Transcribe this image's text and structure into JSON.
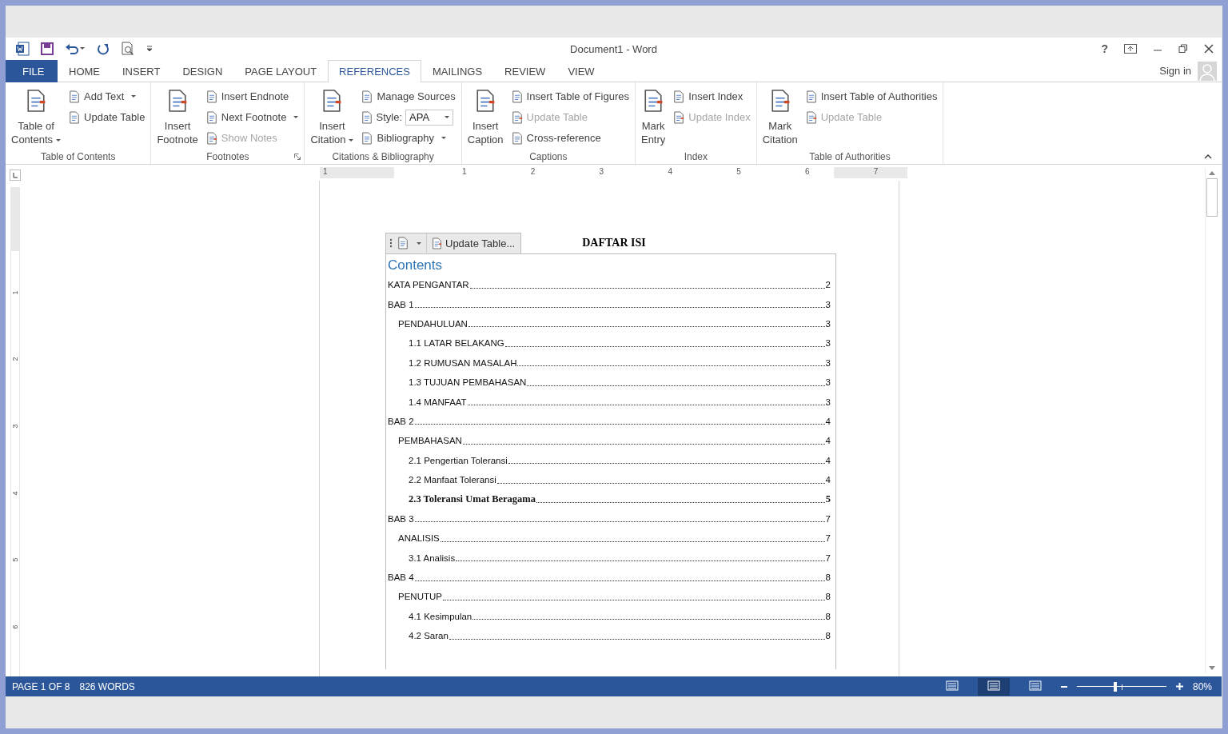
{
  "window": {
    "title": "Document1 - Word",
    "help": "?",
    "sign_in": "Sign in"
  },
  "tabs": [
    {
      "label": "FILE",
      "kind": "file",
      "selected": false
    },
    {
      "label": "HOME",
      "kind": "tab",
      "selected": false
    },
    {
      "label": "INSERT",
      "kind": "tab",
      "selected": false
    },
    {
      "label": "DESIGN",
      "kind": "tab",
      "selected": false
    },
    {
      "label": "PAGE LAYOUT",
      "kind": "tab",
      "selected": false
    },
    {
      "label": "REFERENCES",
      "kind": "tab",
      "selected": true
    },
    {
      "label": "MAILINGS",
      "kind": "tab",
      "selected": false
    },
    {
      "label": "REVIEW",
      "kind": "tab",
      "selected": false
    },
    {
      "label": "VIEW",
      "kind": "tab",
      "selected": false
    }
  ],
  "ribbon": {
    "groups": [
      {
        "label": "Table of Contents",
        "large": [
          {
            "lines": [
              "Table of",
              "Contents"
            ],
            "dropdown": true
          }
        ],
        "small": [
          {
            "kind": "button",
            "label": "Add Text",
            "dropdown": true
          },
          {
            "kind": "button",
            "label": "Update Table"
          }
        ]
      },
      {
        "label": "Footnotes",
        "launcher": true,
        "large": [
          {
            "lines": [
              "Insert",
              "Footnote"
            ]
          }
        ],
        "small": [
          {
            "kind": "button",
            "label": "Insert Endnote"
          },
          {
            "kind": "button",
            "label": "Next Footnote",
            "dropdown": true
          },
          {
            "kind": "button",
            "label": "Show Notes",
            "disabled": true
          }
        ]
      },
      {
        "label": "Citations & Bibliography",
        "large": [
          {
            "lines": [
              "Insert",
              "Citation"
            ],
            "dropdown": true
          }
        ],
        "small": [
          {
            "kind": "button",
            "label": "Manage Sources"
          },
          {
            "kind": "combo",
            "label": "Style:",
            "value": "APA"
          },
          {
            "kind": "button",
            "label": "Bibliography",
            "dropdown": true
          }
        ]
      },
      {
        "label": "Captions",
        "large": [
          {
            "lines": [
              "Insert",
              "Caption"
            ]
          }
        ],
        "small": [
          {
            "kind": "button",
            "label": "Insert Table of Figures"
          },
          {
            "kind": "button",
            "label": "Update Table",
            "disabled": true
          },
          {
            "kind": "button",
            "label": "Cross-reference"
          }
        ]
      },
      {
        "label": "Index",
        "large": [
          {
            "lines": [
              "Mark",
              "Entry"
            ]
          }
        ],
        "small": [
          {
            "kind": "button",
            "label": "Insert Index"
          },
          {
            "kind": "button",
            "label": "Update Index",
            "disabled": true
          }
        ]
      },
      {
        "label": "Table of Authorities",
        "large": [
          {
            "lines": [
              "Mark",
              "Citation"
            ]
          }
        ],
        "small": [
          {
            "kind": "button",
            "label": "Insert Table of Authorities"
          },
          {
            "kind": "button",
            "label": "Update Table",
            "disabled": true
          }
        ]
      }
    ]
  },
  "ruler": {
    "numbers": [
      "1",
      "1",
      "2",
      "3",
      "4",
      "5",
      "6",
      "7"
    ]
  },
  "vertical_ruler": {
    "numbers": [
      "1",
      "2",
      "3",
      "4",
      "5",
      "6"
    ]
  },
  "document": {
    "heading": "DAFTAR ISI",
    "update_button": "Update Table...",
    "toc": {
      "title": "Contents",
      "entries": [
        {
          "text": "KATA PENGANTAR",
          "page": "2"
        },
        {
          "text": "BAB 1",
          "page": "3",
          "children": [
            {
              "text": "PENDAHULUAN",
              "page": "3",
              "children": [
                {
                  "text": "1.1 LATAR BELAKANG",
                  "page": "3"
                },
                {
                  "text": "1.2 RUMUSAN MASALAH",
                  "page": "3"
                },
                {
                  "text": "1.3 TUJUAN PEMBAHASAN",
                  "page": "3"
                },
                {
                  "text": "1.4 MANFAAT",
                  "page": "3"
                }
              ]
            }
          ]
        },
        {
          "text": "BAB 2",
          "page": "4",
          "children": [
            {
              "text": "PEMBAHASAN",
              "page": "4",
              "children": [
                {
                  "text": "2.1 Pengertian Toleransi",
                  "page": "4"
                },
                {
                  "text": "2.2 Manfaat Toleransi",
                  "page": "4"
                },
                {
                  "text": "2.3 Toleransi Umat Beragama",
                  "page": "5",
                  "bold": true
                }
              ]
            }
          ]
        },
        {
          "text": "BAB 3",
          "page": "7",
          "children": [
            {
              "text": "ANALISIS",
              "page": "7",
              "children": [
                {
                  "text": "3.1 Analisis",
                  "page": "7"
                }
              ]
            }
          ]
        },
        {
          "text": "BAB 4",
          "page": "8",
          "children": [
            {
              "text": "PENUTUP",
              "page": "8",
              "children": [
                {
                  "text": "4.1 Kesimpulan",
                  "page": "8"
                },
                {
                  "text": "4.2 Saran",
                  "page": "8"
                }
              ]
            }
          ]
        }
      ]
    }
  },
  "status_bar": {
    "page": "PAGE 1 OF 8",
    "words": "826 WORDS",
    "views": [
      {
        "selected": false
      },
      {
        "selected": true
      },
      {
        "selected": false
      }
    ],
    "zoom": {
      "level": 0.43,
      "reading": "80%"
    }
  }
}
